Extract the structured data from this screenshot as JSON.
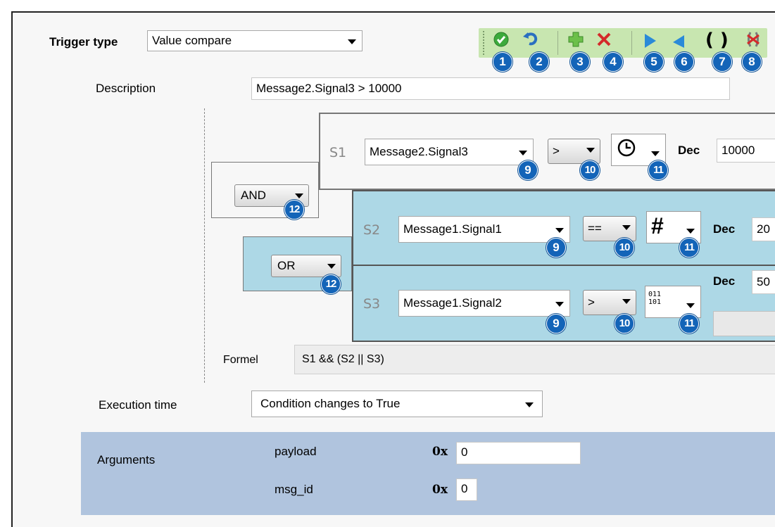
{
  "trigger": {
    "label": "Trigger type",
    "value": "Value compare"
  },
  "toolbar": {
    "badges": [
      "1",
      "2",
      "3",
      "4",
      "5",
      "6",
      "7",
      "8"
    ],
    "icons": [
      "check-icon",
      "undo-icon",
      "add-icon",
      "delete-icon",
      "indent-right-icon",
      "indent-left-icon",
      "parentheses-icon",
      "remove-parentheses-icon"
    ],
    "paren_glyph": "( )"
  },
  "description": {
    "label": "Description",
    "value": "Message2.Signal3  >  10000"
  },
  "conditions": [
    {
      "name": "S1",
      "signal": "Message2.Signal3",
      "operator": ">",
      "format_icon": "clock-icon",
      "dec_label": "Dec",
      "value": "10000"
    },
    {
      "name": "S2",
      "signal": "Message1.Signal1",
      "operator": "==",
      "format_icon": "hash-icon",
      "format_glyph": "#",
      "dec_label": "Dec",
      "value": "20"
    },
    {
      "name": "S3",
      "signal": "Message1.Signal2",
      "operator": ">",
      "format_icon": "binary-icon",
      "format_glyph_top": "011",
      "format_glyph_bottom": "101",
      "dec_label": "Dec",
      "value": "50"
    }
  ],
  "logic": {
    "and": "AND",
    "or": "OR"
  },
  "badges_row": {
    "signal": "9",
    "operator": "10",
    "format": "11",
    "logic": "12"
  },
  "formula": {
    "label": "Formel",
    "value": "S1 && (S2 || S3)"
  },
  "execution": {
    "label": "Execution time",
    "value": "Condition changes to True"
  },
  "arguments": {
    "label": "Arguments",
    "items": [
      {
        "name": "payload",
        "prefix": "0x",
        "value": "0"
      },
      {
        "name": "msg_id",
        "prefix": "0x",
        "value": "0"
      }
    ]
  },
  "colors": {
    "group_fill": "#add8e6",
    "arguments_fill": "#b0c4de",
    "badge": "#1364b8"
  }
}
